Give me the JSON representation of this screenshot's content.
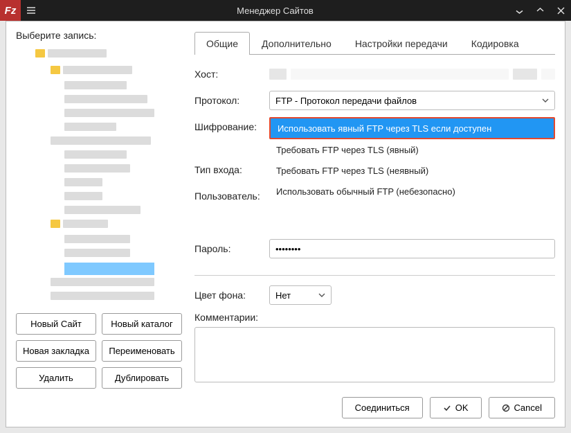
{
  "titlebar": {
    "title": "Менеджер Сайтов"
  },
  "left": {
    "label": "Выберите запись:",
    "buttons": {
      "new_site": "Новый Сайт",
      "new_folder": "Новый каталог",
      "new_bookmark": "Новая закладка",
      "rename": "Переименовать",
      "delete": "Удалить",
      "duplicate": "Дублировать"
    }
  },
  "tabs": {
    "general": "Общие",
    "advanced": "Дополнительно",
    "transfer": "Настройки передачи",
    "charset": "Кодировка"
  },
  "form": {
    "host_label": "Хост:",
    "protocol_label": "Протокол:",
    "protocol_value": "FTP - Протокол передачи файлов",
    "encryption_label": "Шифрование:",
    "encryption_selected": "Использовать явный FTP через TLS если доступен",
    "encryption_options": [
      "Требовать FTP через TLS (явный)",
      "Требовать FTP через TLS (неявный)",
      "Использовать обычный FTP (небезопасно)"
    ],
    "logon_label": "Тип входа:",
    "user_label": "Пользователь:",
    "pass_label": "Пароль:",
    "pass_value": "••••••••",
    "bgcolor_label": "Цвет фона:",
    "bgcolor_value": "Нет",
    "comments_label": "Комментарии:"
  },
  "footer": {
    "connect": "Соединиться",
    "ok": "OK",
    "cancel": "Cancel"
  }
}
